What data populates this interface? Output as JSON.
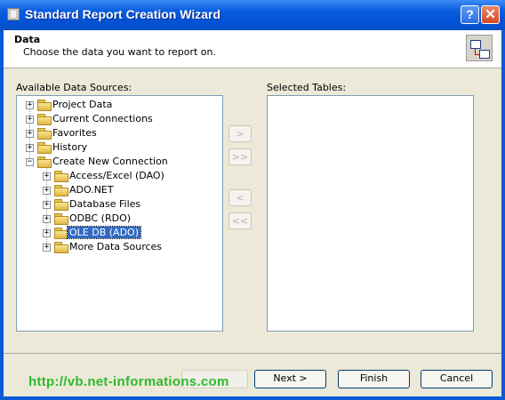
{
  "window": {
    "title": "Standard Report Creation Wizard",
    "help_glyph": "?",
    "close_glyph": "✕"
  },
  "header": {
    "title": "Data",
    "subtitle": "Choose the data you want to report on."
  },
  "available": {
    "label": "Available Data Sources:",
    "tree": [
      {
        "label": "Project Data",
        "level": 0,
        "expander": "+"
      },
      {
        "label": "Current Connections",
        "level": 0,
        "expander": "+"
      },
      {
        "label": "Favorites",
        "level": 0,
        "expander": "+"
      },
      {
        "label": "History",
        "level": 0,
        "expander": "+"
      },
      {
        "label": "Create New Connection",
        "level": 0,
        "expander": "−"
      },
      {
        "label": "Access/Excel (DAO)",
        "level": 1,
        "expander": "+"
      },
      {
        "label": "ADO.NET",
        "level": 1,
        "expander": "+"
      },
      {
        "label": "Database Files",
        "level": 1,
        "expander": "+"
      },
      {
        "label": "ODBC (RDO)",
        "level": 1,
        "expander": "+"
      },
      {
        "label": "OLE DB (ADO)",
        "level": 1,
        "expander": "+",
        "selected": true
      },
      {
        "label": "More Data Sources",
        "level": 1,
        "expander": "+"
      }
    ]
  },
  "selected_tables": {
    "label": "Selected Tables:"
  },
  "transfer": {
    "add": ">",
    "add_all": ">>",
    "remove": "<",
    "remove_all": "<<"
  },
  "footer": {
    "watermark": "http://vb.net-informations.com",
    "next": "Next >",
    "finish": "Finish",
    "cancel": "Cancel"
  }
}
